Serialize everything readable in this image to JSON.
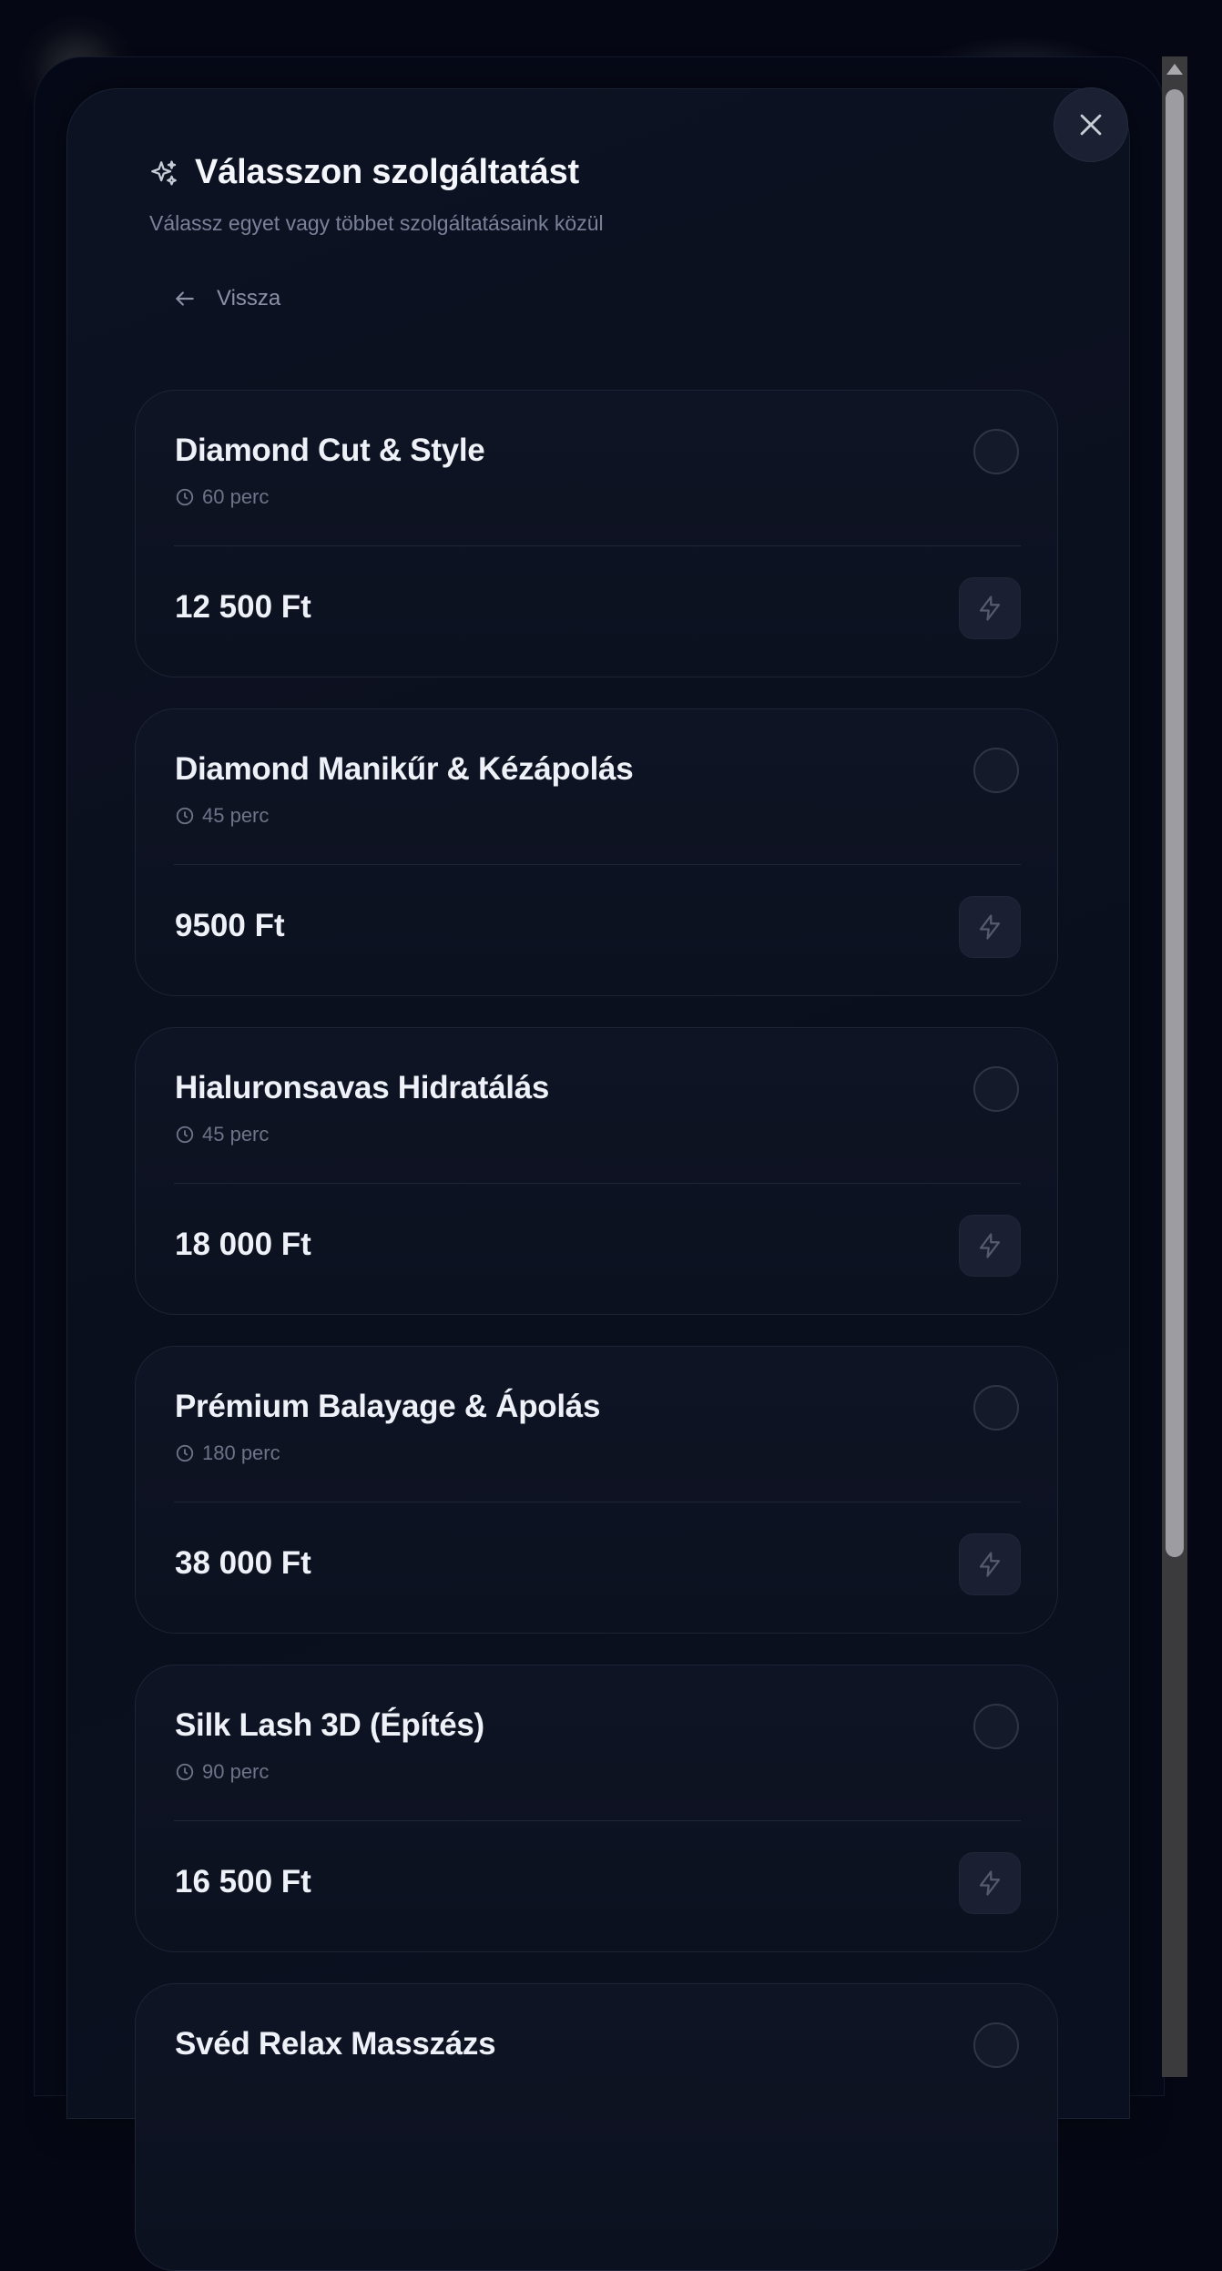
{
  "modal": {
    "title": "Válasszon szolgáltatást",
    "subtitle": "Válassz egyet vagy többet szolgáltatásaink közül",
    "back_label": "Vissza"
  },
  "services": [
    {
      "name": "Diamond Cut & Style",
      "duration": "60 perc",
      "price": "12 500 Ft",
      "selected": false
    },
    {
      "name": "Diamond Manikűr & Kézápolás",
      "duration": "45 perc",
      "price": "9500 Ft",
      "selected": false
    },
    {
      "name": "Hialuronsavas Hidratálás",
      "duration": "45 perc",
      "price": "18 000 Ft",
      "selected": false
    },
    {
      "name": "Prémium Balayage & Ápolás",
      "duration": "180 perc",
      "price": "38 000 Ft",
      "selected": false
    },
    {
      "name": "Silk Lash 3D (Építés)",
      "duration": "90 perc",
      "price": "16 500 Ft",
      "selected": false
    },
    {
      "name": "Svéd Relax Masszázs",
      "duration": "",
      "price": "",
      "selected": false
    }
  ],
  "icons": {
    "close": "close-icon",
    "sparkles": "sparkles-icon",
    "back": "arrow-left-icon",
    "clock": "clock-icon",
    "bolt": "lightning-bolt-icon"
  },
  "colors": {
    "background": "#050814",
    "modal": "#0c1120",
    "card": "#0f1424",
    "text_primary": "#eef1f7",
    "text_muted": "#7a8299"
  }
}
